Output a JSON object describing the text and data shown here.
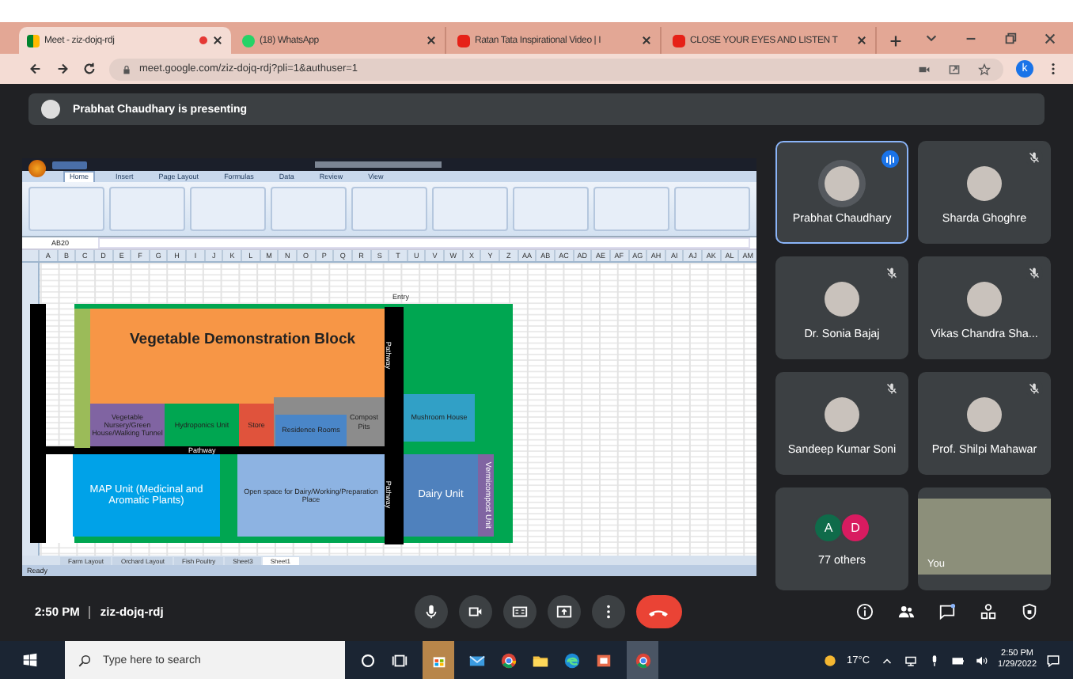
{
  "browser": {
    "tabs": [
      {
        "title": "Meet - ziz-dojq-rdj",
        "kind": "meet",
        "selected": true,
        "recording": true
      },
      {
        "title": "(18) WhatsApp",
        "kind": "whatsapp",
        "selected": false,
        "recording": false
      },
      {
        "title": "Ratan Tata Inspirational Video | I",
        "kind": "youtube",
        "selected": false,
        "recording": false
      },
      {
        "title": "CLOSE YOUR EYES AND LISTEN T",
        "kind": "youtube",
        "selected": false,
        "recording": false
      }
    ],
    "url": "meet.google.com/ziz-dojq-rdj?pli=1&authuser=1",
    "profile": "k"
  },
  "banner": {
    "text": "Prabhat Chaudhary is presenting"
  },
  "excel": {
    "ribbon_tabs": [
      {
        "label": "Home",
        "selected": true
      },
      {
        "label": "Insert",
        "selected": false
      },
      {
        "label": "Page Layout",
        "selected": false
      },
      {
        "label": "Formulas",
        "selected": false
      },
      {
        "label": "Data",
        "selected": false
      },
      {
        "label": "Review",
        "selected": false
      },
      {
        "label": "View",
        "selected": false
      }
    ],
    "name_box": "AB20",
    "columns": [
      "A",
      "B",
      "C",
      "D",
      "E",
      "F",
      "G",
      "H",
      "I",
      "J",
      "K",
      "L",
      "M",
      "N",
      "O",
      "P",
      "Q",
      "R",
      "S",
      "T",
      "U",
      "V",
      "W",
      "X",
      "Y",
      "Z",
      "AA",
      "AB",
      "AC",
      "AD",
      "AE",
      "AF",
      "AG",
      "AH",
      "AI",
      "AJ",
      "AK",
      "AL",
      "AM"
    ],
    "cell_label": "Entry",
    "blocks": [
      {
        "kind": "veg",
        "label": "Vegetable Demonstration Block",
        "color": "#f79646"
      },
      {
        "kind": "nursery",
        "label": "Vegetable Nursery/Green House/Walking Tunnel",
        "color": "#8064a2"
      },
      {
        "kind": "hydro",
        "label": "Hydroponics Unit",
        "color": "#00a651"
      },
      {
        "kind": "store",
        "label": "Store",
        "color": "#e0533c"
      },
      {
        "kind": "compost",
        "label": "Compost Pits",
        "color": "#8c8c8c"
      },
      {
        "kind": "residence",
        "label": "Residence Rooms",
        "color": "#4a86c8"
      },
      {
        "kind": "mushroom",
        "label": "Mushroom House",
        "color": "#31a0c6"
      },
      {
        "kind": "map",
        "label": "MAP Unit (Medicinal and Aromatic Plants)",
        "color": "#00a2e8"
      },
      {
        "kind": "open",
        "label": "Open space for Dairy/Working/Preparation Place",
        "color": "#8db3e2"
      },
      {
        "kind": "dairy",
        "label": "Dairy Unit",
        "color": "#4f81bd"
      },
      {
        "kind": "vermi",
        "label": "Vermicompost Unit",
        "color": "#8064a2"
      }
    ],
    "pathways": [
      "Pathway",
      "Pathway",
      "Pathway"
    ],
    "sheets": [
      {
        "label": "Farm Layout",
        "selected": false
      },
      {
        "label": "Orchard Layout",
        "selected": false
      },
      {
        "label": "Fish Poultry",
        "selected": false
      },
      {
        "label": "Sheet3",
        "selected": false
      },
      {
        "label": "Sheet1",
        "selected": true
      }
    ],
    "status": "Ready"
  },
  "tiles": [
    {
      "kind": "person",
      "name": "Prabhat Chaudhary",
      "speaking": true
    },
    {
      "kind": "person",
      "name": "Sharda Ghoghre",
      "speaking": false,
      "muted": true
    },
    {
      "kind": "person",
      "name": "Dr. Sonia Bajaj",
      "speaking": false,
      "muted": true
    },
    {
      "kind": "person",
      "name": "Vikas Chandra Sha...",
      "speaking": false,
      "muted": true
    },
    {
      "kind": "person",
      "name": "Sandeep Kumar Soni",
      "speaking": false,
      "muted": true
    },
    {
      "kind": "person",
      "name": "Prof. Shilpi Mahawar",
      "speaking": false,
      "muted": true
    },
    {
      "kind": "others",
      "name": "77 others",
      "initials": [
        {
          "letter": "A",
          "color": "#0f6b4a"
        },
        {
          "letter": "D",
          "color": "#d81b60"
        }
      ]
    },
    {
      "kind": "self",
      "name": "You"
    }
  ],
  "meeting": {
    "time": "2:50 PM",
    "code": "ziz-dojq-rdj"
  },
  "taskbar": {
    "search": {
      "placeholder": "Type here to search"
    },
    "weather": "17°C",
    "time": "2:50 PM",
    "date": "1/29/2022"
  }
}
